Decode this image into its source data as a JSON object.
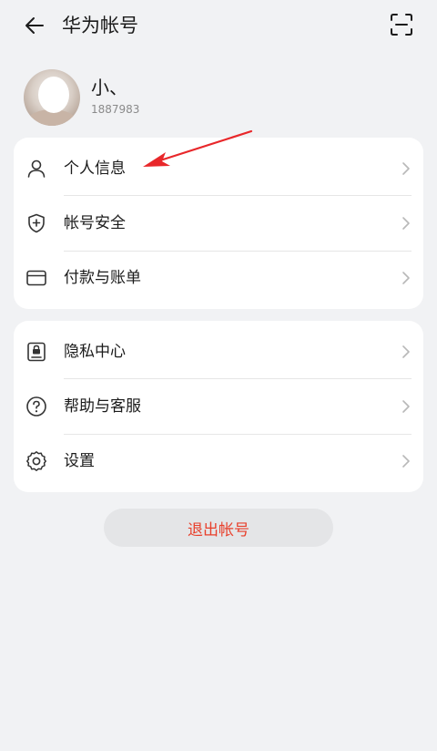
{
  "header": {
    "title": "华为帐号",
    "back_icon": "arrow-left-icon",
    "scan_icon": "scan-icon"
  },
  "profile": {
    "name": "小、",
    "phone": "1887983"
  },
  "group1": [
    {
      "label": "个人信息",
      "icon": "person-icon"
    },
    {
      "label": "帐号安全",
      "icon": "shield-plus-icon"
    },
    {
      "label": "付款与账单",
      "icon": "card-icon"
    }
  ],
  "group2": [
    {
      "label": "隐私中心",
      "icon": "id-lock-icon"
    },
    {
      "label": "帮助与客服",
      "icon": "help-icon"
    },
    {
      "label": "设置",
      "icon": "gear-icon"
    }
  ],
  "logout": {
    "label": "退出帐号"
  },
  "colors": {
    "background": "#f1f2f4",
    "card": "#ffffff",
    "logout_text": "#e8402c",
    "annotation_arrow": "#e8272a"
  }
}
